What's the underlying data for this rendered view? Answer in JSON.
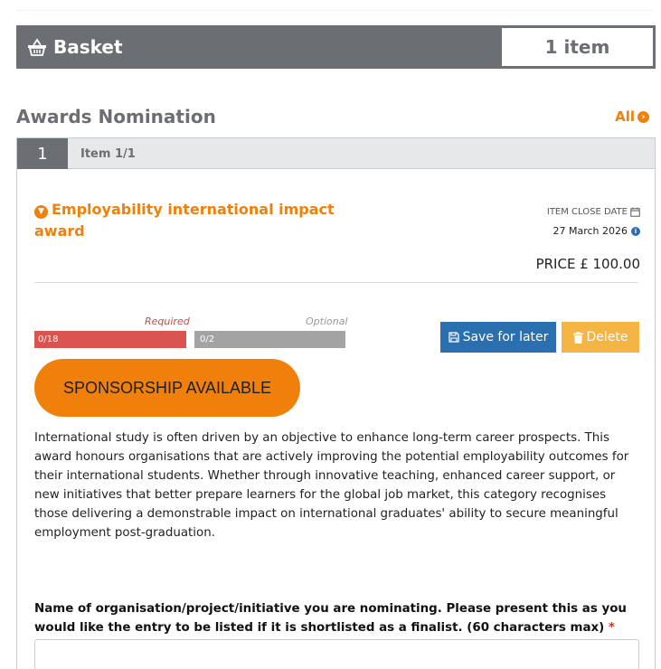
{
  "basket": {
    "title": "Basket",
    "count": "1 item",
    "icon": "basket-icon"
  },
  "section": {
    "title": "Awards Nomination",
    "all_label": "All"
  },
  "item": {
    "number": "1",
    "label": "Item 1/1",
    "title": "Employability international impact award",
    "close_date_label": "ITEM CLOSE DATE",
    "close_date": "27 March 2026",
    "price": "PRICE £ 100.00"
  },
  "progress": {
    "required_label": "Required",
    "required_value": "0/18",
    "optional_label": "Optional",
    "optional_value": "0/2"
  },
  "buttons": {
    "save": "Save for later",
    "delete": "Delete"
  },
  "sponsorship": "SPONSORSHIP AVAILABLE",
  "description": "International study is often driven by an objective to enhance long-term career prospects. This award honours organisations that are actively improving the potential employability outcomes for their international students. Whether through innovative teaching, enhanced career support, or new initiatives that better prepare learners for the global job market, this category recognises those delivering a demonstrable impact on international graduates' ability to secure meaningful employment post-graduation.",
  "form": {
    "field_label": "Name of organisation/project/initiative you are nominating. Please present this as you would like the entry to be listed if it is shortlisted as a finalist. (60 characters max)",
    "required_marker": "*",
    "field_value": ""
  },
  "colors": {
    "accent": "#f0800a",
    "header_gray": "#6b6e72",
    "required_red": "#d9534f",
    "save_blue": "#2a6fb0",
    "delete_yellow": "#f4b545"
  }
}
